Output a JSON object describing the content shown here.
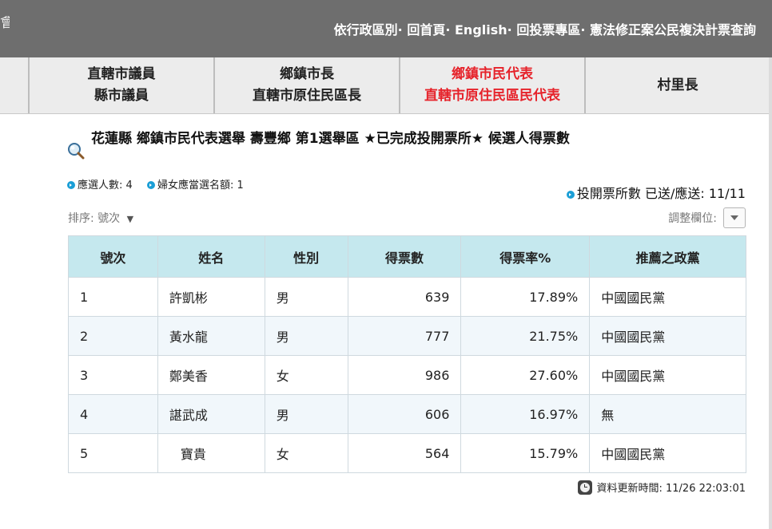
{
  "header": {
    "logo_fragment": "會",
    "nav": [
      {
        "label": "依行政區別"
      },
      {
        "label": "回首頁"
      },
      {
        "label": "English"
      },
      {
        "label": "回投票專區"
      },
      {
        "label": "憲法修正案公民複決計票查詢"
      }
    ],
    "separator": "·"
  },
  "tabs": [
    {
      "line1": "直轄市議員",
      "line2": "縣市議員",
      "active": false
    },
    {
      "line1": "鄉鎮市長",
      "line2": "直轄市原住民區長",
      "active": false
    },
    {
      "line1": "鄉鎮市民代表",
      "line2": "直轄市原住民區民代表",
      "active": true
    },
    {
      "line1": "村里長",
      "line2": "",
      "active": false
    }
  ],
  "title": "花蓮縣 鄉鎮市民代表選舉 壽豐鄉 第1選舉區 ★已完成投開票所★ 候選人得票數",
  "meta": {
    "seats": "應選人數: 4",
    "women_quota": "婦女應當選名額: 1",
    "stations": "投開票所數 已送/應送: 11/11"
  },
  "sort": {
    "label": "排序:",
    "value": "號次"
  },
  "adjust_columns": "調整欄位:",
  "table": {
    "headers": [
      "號次",
      "姓名",
      "性別",
      "得票數",
      "得票率%",
      "推薦之政黨"
    ],
    "rows": [
      {
        "no": "1",
        "name": "許凱彬",
        "gender": "男",
        "votes": "639",
        "rate": "17.89%",
        "party": "中國國民黨"
      },
      {
        "no": "2",
        "name": "黃水龍",
        "gender": "男",
        "votes": "777",
        "rate": "21.75%",
        "party": "中國國民黨"
      },
      {
        "no": "3",
        "name": "鄭美香",
        "gender": "女",
        "votes": "986",
        "rate": "27.60%",
        "party": "中國國民黨"
      },
      {
        "no": "4",
        "name": "諶武成",
        "gender": "男",
        "votes": "606",
        "rate": "16.97%",
        "party": "無"
      },
      {
        "no": "5",
        "name": "寶貴",
        "gender": "女",
        "votes": "564",
        "rate": "15.79%",
        "party": "中國國民黨"
      }
    ]
  },
  "update_time": "資料更新時間: 11/26 22:03:01",
  "colors": {
    "header_bg": "#6e6e6e",
    "active_tab": "#e6232b",
    "table_header_bg": "#c5e8ee",
    "bullet": "#1a9ed6"
  }
}
